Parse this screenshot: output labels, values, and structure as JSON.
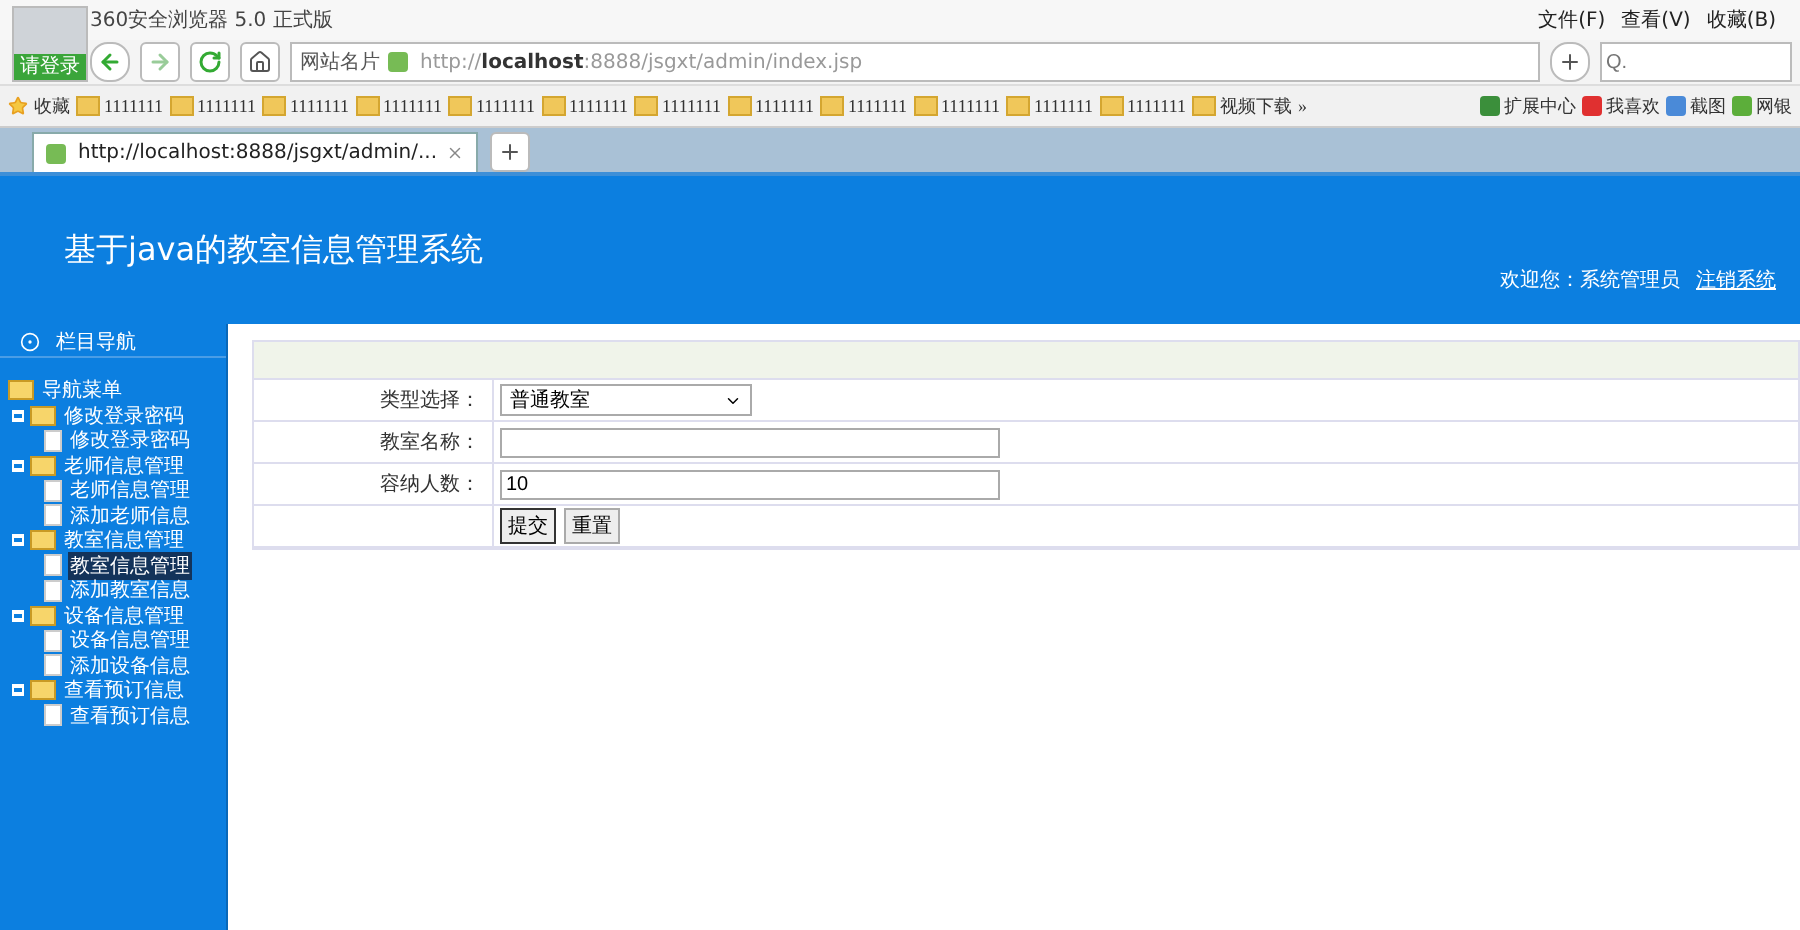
{
  "browser": {
    "title": "360安全浏览器 5.0 正式版",
    "login_label": "请登录",
    "menu": [
      "文件(F)",
      "查看(V)",
      "收藏(B)"
    ],
    "site_button": "网站名片",
    "address": {
      "prefix": "http://",
      "host": "localhost",
      "rest": ":8888/jsgxt/admin/index.jsp"
    },
    "search": {
      "placeholder": "Q."
    },
    "bookmarks_label": "收藏",
    "bookmarks": [
      "1111111",
      "1111111",
      "1111111",
      "1111111",
      "1111111",
      "1111111",
      "1111111",
      "1111111",
      "1111111",
      "1111111",
      "1111111",
      "1111111",
      "视频下载"
    ],
    "more": "»",
    "extras": [
      {
        "label": "扩展中心",
        "kind": "ext"
      },
      {
        "label": "我喜欢",
        "kind": "like"
      },
      {
        "label": "截图",
        "kind": "shot"
      },
      {
        "label": "网银",
        "kind": "bank"
      }
    ],
    "tabs": [
      {
        "label": "http://localhost:8888/jsgxt/admin/...",
        "selected": true
      }
    ]
  },
  "header": {
    "title": "基于java的教室信息管理系统",
    "welcome": "欢迎您：系统管理员",
    "logout": "注销系统"
  },
  "sidebar": {
    "title": "栏目导航",
    "tree": {
      "label": "导航菜单",
      "children": [
        {
          "label": "修改登录密码",
          "expanded": true,
          "children": [
            {
              "label": "修改登录密码",
              "selected": false
            }
          ]
        },
        {
          "label": "老师信息管理",
          "expanded": true,
          "children": [
            {
              "label": "老师信息管理",
              "selected": false
            },
            {
              "label": "添加老师信息",
              "selected": false
            }
          ]
        },
        {
          "label": "教室信息管理",
          "expanded": true,
          "children": [
            {
              "label": "教室信息管理",
              "selected": true
            },
            {
              "label": "添加教室信息",
              "selected": false
            }
          ]
        },
        {
          "label": "设备信息管理",
          "expanded": true,
          "children": [
            {
              "label": "设备信息管理",
              "selected": false
            },
            {
              "label": "添加设备信息",
              "selected": false
            }
          ]
        },
        {
          "label": "查看预订信息",
          "expanded": true,
          "children": [
            {
              "label": "查看预订信息",
              "selected": false
            }
          ]
        }
      ]
    }
  },
  "form": {
    "fields": [
      {
        "label": "类型选择：",
        "kind": "select",
        "value": "普通教室"
      },
      {
        "label": "教室名称：",
        "kind": "text"
      },
      {
        "label": "容纳人数：",
        "kind": "text",
        "value": "10"
      }
    ],
    "buttons": [
      "提交",
      "重置"
    ]
  }
}
